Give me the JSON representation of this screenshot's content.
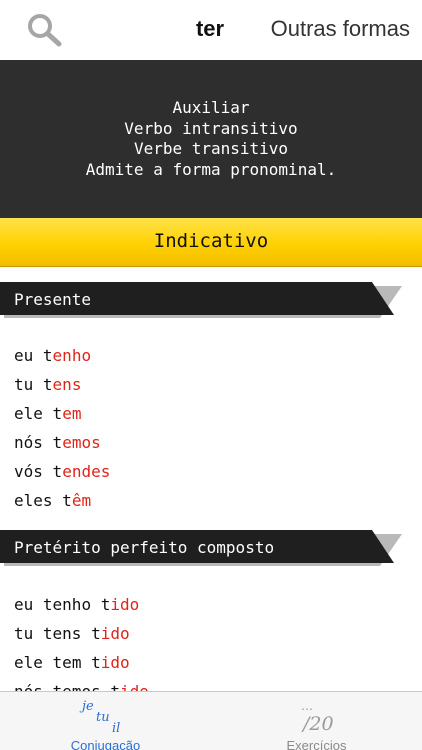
{
  "header": {
    "search_icon": "search-icon",
    "verb": "ter",
    "other_forms_label": "Outras formas"
  },
  "info": {
    "lines": [
      "Auxiliar",
      "Verbo intransitivo",
      "Verbe transitivo",
      "Admite a forma pronominal."
    ]
  },
  "mood": {
    "label": "Indicativo",
    "color": "#ffd100"
  },
  "tenses": [
    {
      "name": "Presente",
      "rows": [
        {
          "pronoun": "eu",
          "stem": "t",
          "ending": "enho"
        },
        {
          "pronoun": "tu",
          "stem": "t",
          "ending": "ens"
        },
        {
          "pronoun": "ele",
          "stem": "t",
          "ending": "em"
        },
        {
          "pronoun": "nós",
          "stem": "t",
          "ending": "emos"
        },
        {
          "pronoun": "vós",
          "stem": "t",
          "ending": "endes"
        },
        {
          "pronoun": "eles",
          "stem": "t",
          "ending": "êm"
        }
      ]
    },
    {
      "name": "Pretérito perfeito composto",
      "rows": [
        {
          "pronoun": "eu",
          "aux": "tenho",
          "stem": "t",
          "ending": "ido"
        },
        {
          "pronoun": "tu",
          "aux": "tens",
          "stem": "t",
          "ending": "ido"
        },
        {
          "pronoun": "ele",
          "aux": "tem",
          "stem": "t",
          "ending": "ido"
        },
        {
          "pronoun": "nós",
          "aux": "temos",
          "stem": "t",
          "ending": "ido"
        }
      ]
    }
  ],
  "tabbar": {
    "tabs": [
      {
        "label": "Conjugação",
        "icon": "conjugation-icon",
        "icon_text": [
          "je",
          "tu",
          "il"
        ],
        "active": true
      },
      {
        "label": "Exercícios",
        "icon": "exercises-icon",
        "icon_text": [
          "…",
          "/20"
        ],
        "active": false
      }
    ]
  },
  "colors": {
    "accent": "#2b6fd6",
    "ending": "#e0241a",
    "panel": "#2e2e2e",
    "tense_header": "#1f1f1f"
  }
}
